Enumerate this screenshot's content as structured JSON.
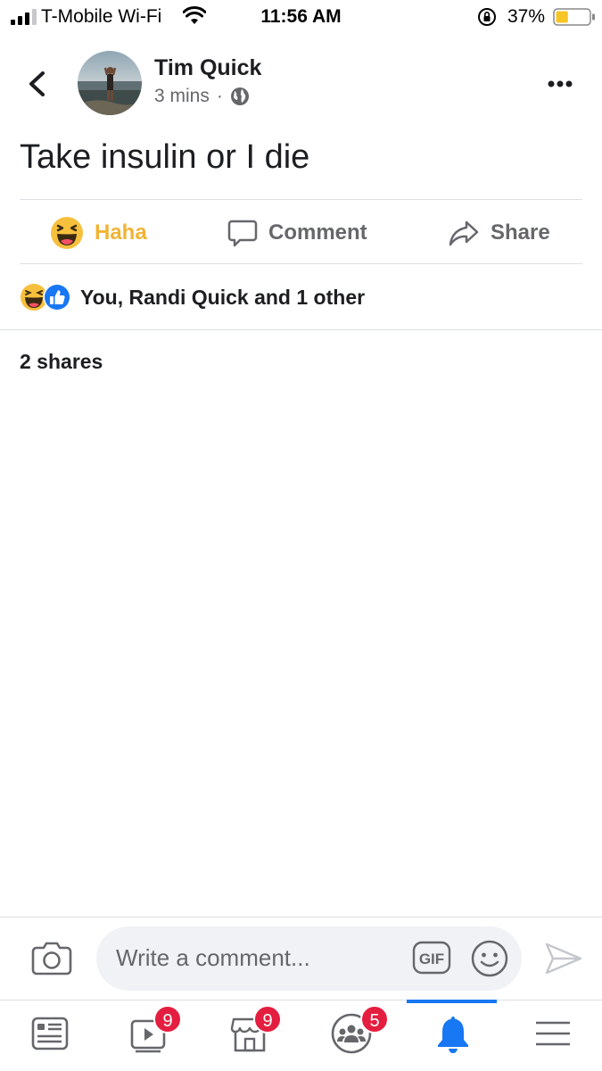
{
  "status_bar": {
    "carrier": "T-Mobile Wi-Fi",
    "time": "11:56 AM",
    "battery_percent": "37%",
    "battery_level": 0.37,
    "battery_color": "#f7c625"
  },
  "post": {
    "author": "Tim Quick",
    "time": "3 mins",
    "separator": "·",
    "privacy_icon": "globe-icon",
    "text": "Take insulin or I die"
  },
  "actions": {
    "haha_label": "Haha",
    "comment_label": "Comment",
    "share_label": "Share"
  },
  "reactions": {
    "summary": "You, Randi Quick and 1 other",
    "icons": [
      "haha-reaction-icon",
      "like-reaction-icon"
    ]
  },
  "shares": "2 shares",
  "composer": {
    "placeholder": "Write a comment...",
    "gif_label": "GIF"
  },
  "tab_bar": {
    "items": [
      {
        "name": "news-feed",
        "badge": ""
      },
      {
        "name": "watch",
        "badge": "9"
      },
      {
        "name": "marketplace",
        "badge": "9"
      },
      {
        "name": "groups",
        "badge": "5"
      },
      {
        "name": "notifications",
        "badge": "",
        "active": true
      },
      {
        "name": "menu",
        "badge": ""
      }
    ]
  },
  "colors": {
    "accent": "#1877f2",
    "haha": "#f0b433",
    "badge": "#e41e3f"
  }
}
